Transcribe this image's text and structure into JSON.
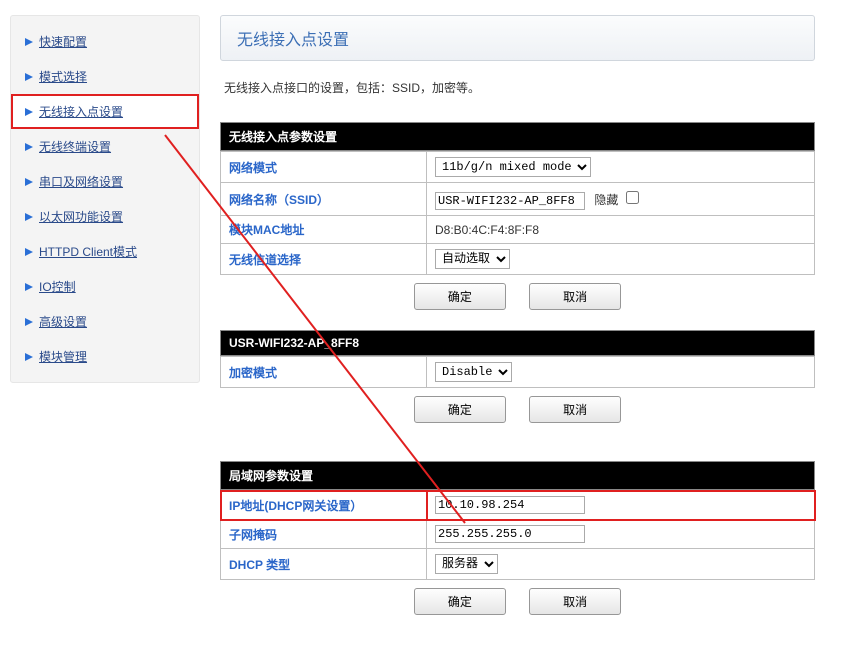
{
  "sidebar": {
    "items": [
      {
        "label": "快速配置"
      },
      {
        "label": "模式选择"
      },
      {
        "label": "无线接入点设置"
      },
      {
        "label": "无线终端设置"
      },
      {
        "label": "串口及网络设置"
      },
      {
        "label": "以太网功能设置"
      },
      {
        "label": "HTTPD Client模式"
      },
      {
        "label": "IO控制"
      },
      {
        "label": "高级设置"
      },
      {
        "label": "模块管理"
      }
    ]
  },
  "page": {
    "title": "无线接入点设置",
    "desc": "无线接入点接口的设置，包括：SSID，加密等。"
  },
  "ap_params": {
    "header": "无线接入点参数设置",
    "mode_label": "网络模式",
    "mode_value": "11b/g/n mixed mode",
    "ssid_label": "网络名称（SSID）",
    "ssid_value": "USR-WIFI232-AP_8FF8",
    "ssid_hide_label": "隐藏",
    "ssid_hide_checked": false,
    "mac_label": "模块MAC地址",
    "mac_value": "D8:B0:4C:F4:8F:F8",
    "channel_label": "无线信道选择",
    "channel_value": "自动选取",
    "btn_ok": "确定",
    "btn_cancel": "取消"
  },
  "sec_params": {
    "header": "USR-WIFI232-AP_8FF8",
    "enc_label": "加密模式",
    "enc_value": "Disable",
    "btn_ok": "确定",
    "btn_cancel": "取消"
  },
  "lan_params": {
    "header": "局域网参数设置",
    "ip_label": "IP地址(DHCP网关设置）",
    "ip_value": "10.10.98.254",
    "mask_label": "子网掩码",
    "mask_value": "255.255.255.0",
    "dhcp_label": "DHCP 类型",
    "dhcp_value": "服务器",
    "btn_ok": "确定",
    "btn_cancel": "取消"
  }
}
